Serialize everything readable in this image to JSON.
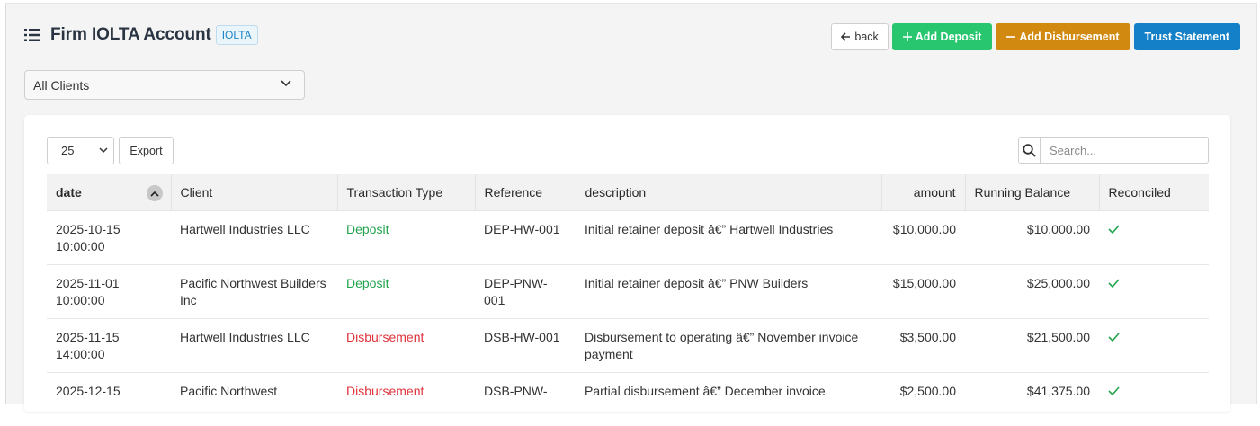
{
  "header": {
    "title": "Firm IOLTA Account",
    "badge": "IOLTA",
    "back_label": "back",
    "add_deposit_label": "Add Deposit",
    "add_disbursement_label": "Add Disbursement",
    "trust_statement_label": "Trust Statement"
  },
  "filter": {
    "client_value": "All Clients"
  },
  "table_controls": {
    "page_length": "25",
    "export_label": "Export",
    "search_placeholder": "Search..."
  },
  "table": {
    "columns": [
      "date",
      "Client",
      "Transaction Type",
      "Reference",
      "description",
      "amount",
      "Running Balance",
      "Reconciled"
    ],
    "rows": [
      {
        "date": "2025-10-15 10:00:00",
        "client": "Hartwell Industries LLC",
        "type": "Deposit",
        "reference": "DEP-HW-001",
        "description": "Initial retainer deposit â€” Hartwell Industries",
        "amount": "$10,000.00",
        "balance": "$10,000.00",
        "reconciled": true
      },
      {
        "date": "2025-11-01 10:00:00",
        "client": "Pacific Northwest Builders Inc",
        "type": "Deposit",
        "reference": "DEP-PNW-001",
        "description": "Initial retainer deposit â€” PNW Builders",
        "amount": "$15,000.00",
        "balance": "$25,000.00",
        "reconciled": true
      },
      {
        "date": "2025-11-15 14:00:00",
        "client": "Hartwell Industries LLC",
        "type": "Disbursement",
        "reference": "DSB-HW-001",
        "description": "Disbursement to operating â€” November invoice payment",
        "amount": "$3,500.00",
        "balance": "$21,500.00",
        "reconciled": true
      },
      {
        "date": "2025-12-15",
        "client": "Pacific Northwest",
        "type": "Disbursement",
        "reference": "DSB-PNW-",
        "description": "Partial disbursement â€” December invoice",
        "amount": "$2,500.00",
        "balance": "$41,375.00",
        "reconciled": true
      }
    ]
  },
  "colors": {
    "deposit": "#22a34d",
    "disbursement": "#e0323a",
    "add_deposit_bg": "#28c76f",
    "add_disbursement_bg": "#d18a0f",
    "trust_statement_bg": "#1480c8",
    "reconciled_check": "#22a34d"
  },
  "icons": {
    "title": "list-icon",
    "back": "arrow-left-icon",
    "deposit": "plus-icon",
    "disbursement": "minus-icon",
    "search": "search-icon",
    "sort": "chevron-up-icon",
    "reconciled": "check-icon"
  }
}
